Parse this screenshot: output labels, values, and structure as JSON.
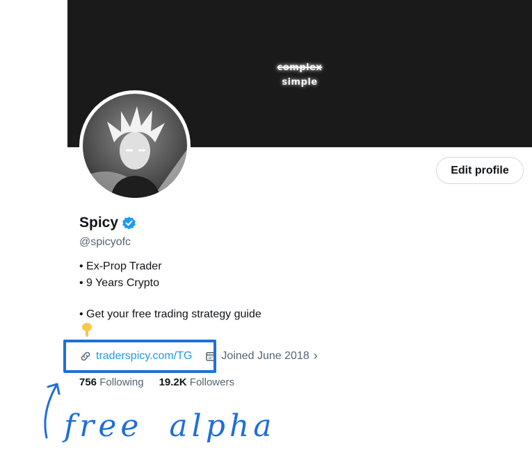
{
  "banner": {
    "line1": "complex",
    "line2": "simple"
  },
  "profile": {
    "edit_label": "Edit profile",
    "display_name": "Spicy",
    "handle": "@spicyofc",
    "bio": [
      "• Ex-Prop Trader",
      "• 9 Years Crypto",
      "• Get your free trading strategy guide"
    ],
    "link": "traderspicy.com/TG",
    "joined": "Joined June 2018",
    "following_count": "756",
    "following_label": "Following",
    "followers_count": "19.2K",
    "followers_label": "Followers"
  },
  "annotation": {
    "text": "free alpha"
  },
  "colors": {
    "accent": "#1d9bf0",
    "annotation": "#1f6ed8",
    "muted": "#536471",
    "banner": "#1a1a1a"
  },
  "icons": {
    "verified": "verified-badge-icon",
    "link": "link-icon",
    "calendar": "calendar-icon",
    "chevron": "chevron-right-icon",
    "hand": "pointing-down-hand-icon"
  }
}
